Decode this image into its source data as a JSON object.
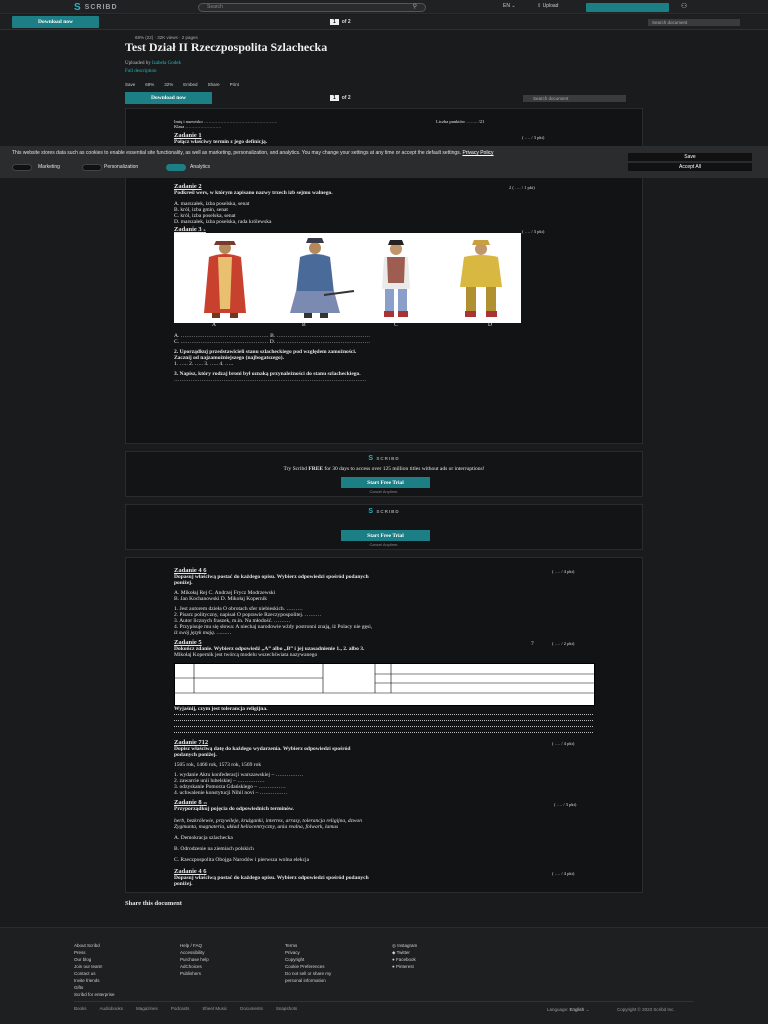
{
  "topbar": {
    "brand": "SCRIBD",
    "search_placeholder": "Search",
    "lang_label": "EN",
    "upload_label": "Upload"
  },
  "subbar": {
    "download_label": "Download now",
    "page_current": "1",
    "page_total": "of 2",
    "search_doc_placeholder": "Search document"
  },
  "doc": {
    "meta": "68% (22) · 32K views · 2 pages",
    "title": "Test Dział II Rzeczpospolita Szlachecka",
    "uploaded_by_label": "Uploaded by",
    "uploader": "Izabela Godek",
    "full_description": "Full description",
    "actions": [
      "Save",
      "68%",
      "32%",
      "Embed",
      "Share",
      "Print"
    ],
    "download_label": "Download now",
    "page_current": "1",
    "page_total": "of 2",
    "search_doc_placeholder": "Search document"
  },
  "page1": {
    "name_line": "Imię i nazwisko ………………………………………….",
    "class_line": "Klasa ……………………",
    "points_line": "Liczba punktów …….. /21",
    "z1_title": "Zadanie 1",
    "z1_text": "Połącz właściwy termin z jego definicją.",
    "z1_pts": "( …. / 3 pkt)",
    "z2_title": "Zadanie 2",
    "z2_text": "Podkreśl wers, w którym zapisano nazwy trzech izb sejmu walnego.",
    "z2_pts": "2 ( …. / 1 pkt)",
    "z2_options": [
      "A. marszałek, izba poselska, senat",
      "B. król, izba gmin, senat",
      "C. król, izba poselska, senat",
      "D. marszałek, izba poselska, rada królewska"
    ],
    "z3_title": "Zadanie 3",
    "z3_suffix": "1.",
    "z3_pts": "( …. / 3 pkt)",
    "fig_labels": [
      "A",
      "B",
      "C",
      "D"
    ],
    "z3_lines": [
      "A. ………………………………………… B. ……………………………………………",
      "C. ………………………………………… D. ……………………………………………"
    ],
    "z3_q2": "2. Uporządkuj przedstawicieli stanu szlacheckiego pod względem zamożności.",
    "z3_q2b": "Zacznij od najzamożniejszego (najbogatszego).",
    "z3_q2c": "1. ….. 2. ….. 3. ….. 4. …..",
    "z3_q3": "3. Napisz, który rodzaj broni był oznaką przynależności do stanu szlacheckiego.",
    "z3_q3_dots": "……………………………………………………………………………………………"
  },
  "cookie": {
    "text": "This website stores data such as cookies to enable essential site functionality, as well as marketing, personalization, and analytics. You may change your settings at any time or accept the default settings.",
    "policy_link": "Privacy Policy",
    "toggles": [
      {
        "label": "Marketing",
        "on": false
      },
      {
        "label": "Personalization",
        "on": false
      },
      {
        "label": "Analytics",
        "on": true
      }
    ],
    "save_label": "Save",
    "accept_label": "Accept All"
  },
  "promo1": {
    "brand": "SCRIBD",
    "text_pre": "Try Scribd ",
    "text_bold": "FREE",
    "text_post": " for 30 days to access over 125 million titles without ads or interruptions!",
    "button": "Start Free Trial",
    "cancel": "Cancel Anytime."
  },
  "promo2": {
    "brand": "SCRIBD",
    "button": "Start Free Trial",
    "cancel": "Cancel Anytime."
  },
  "page2": {
    "z4_title": "Zadanie 4",
    "z4_suffix": "6",
    "z4_pts": "( …. / 4 pkt)",
    "z4_text": "Dopasuj właściwą postać do każdego opisu. Wybierz odpowiedzi spośród podanych",
    "z4_text2": "poniżej.",
    "z4_people1": "A. Mikołaj Rej C. Andrzej Frycz Modrzewski",
    "z4_people2": "B. Jan Kochanowski D. Mikołaj Kopernik",
    "z4_items": [
      "1. Jest autorem dzieła O obrotach sfer niebieskich. ………",
      "2. Pisarz polityczny, napisał O poprawie Rzeczypospolitej. ………",
      "3. Autor licznych fraszek, m.in. Na młodość. ………",
      "4. Przypisuje mu się słowa: A niechaj narodowie wżdy postronni znają, iż Polacy nie gęsi,",
      "    iż swój język mają. ………"
    ],
    "z5_title": "Zadanie 5",
    "z5_pts": "( …. / 2 pkt)",
    "z5_mark": "7",
    "z5_text": "Dokończ zdanie. Wybierz odpowiedź „A” albo „B” i jej uzasadnienie 1., 2. albo 3.",
    "z5_text2": "Mikołaj Kopernik jest twórcą modelu wszechświata nazywanego",
    "z5_explain": "Wyjaśnij, czym jest tolerancja religijna.",
    "z7_title": "Zadanie 7",
    "z7_suffix": "12",
    "z7_pts": "( …. / 4 pkt)",
    "z7_text": "Dopisz właściwą datę do każdego wydarzenia. Wybierz odpowiedzi spośród",
    "z7_text2": "podanych poniżej.",
    "z7_dates": "1505 rok, 1466 rok, 1573 rok, 1569 rok",
    "z7_items": [
      "1. wydanie Aktu konfederacji warszawskiej – ……………",
      "2. zawarcie unii lubelskiej – ……………",
      "3. odzyskanie Pomorza Gdańskiego – ……………",
      "4. uchwalenie konstytucji Nihil novi – ……………"
    ],
    "z8_title": "Zadanie 8",
    "z8_suffix": "13",
    "z8_pts": "( …. / 3 pkt)",
    "z8_text": "Przyporządkuj pojęcia do odpowiednich terminów.",
    "z8_terms1": "herb, bezkrólewie, przywileje, krużganki, interrex, arrasy, tolerancja religijna, dzwon",
    "z8_terms2": "Zygmunta, magnateria, układ heliocentryczny, unia realna, folwark, lamus",
    "z8_opts": [
      "A. Demokracja szlachecka",
      "B. Odrodzenie na ziemiach polskich",
      "C. Rzeczpospolita Obojga Narodów i pierwsza wolna elekcja"
    ],
    "z4b_title": "Zadanie 4",
    "z4b_suffix": "6",
    "z4b_pts": "( …. / 4 pkt)",
    "z4b_text": "Dopasuj właściwą postać do każdego opisu. Wybierz odpowiedzi spośród podanych",
    "z4b_text2": "poniżej."
  },
  "share_label": "Share this document",
  "footer": {
    "col1": [
      "About Scribd",
      "Press",
      "Our blog",
      "Join our team!",
      "Contact us",
      "Invite friends",
      "Gifts",
      "Scribd for enterprise"
    ],
    "col2": [
      "Help / FAQ",
      "Accessibility",
      "Purchase help",
      "AdChoices",
      "Publishers"
    ],
    "col3": [
      "Terms",
      "Privacy",
      "Copyright",
      "Cookie Preferences",
      "Do not sell or share my",
      "personal information"
    ],
    "col4": [
      "Instagram",
      "Twitter",
      "Facebook",
      "Pinterest"
    ],
    "bottom_links": [
      "Books",
      "Audiobooks",
      "Magazines",
      "Podcasts",
      "Sheet Music",
      "Documents",
      "Snapshots"
    ],
    "language_label": "Language:",
    "language_value": "English",
    "copyright": "Copyright © 2023 Scribd Inc."
  }
}
